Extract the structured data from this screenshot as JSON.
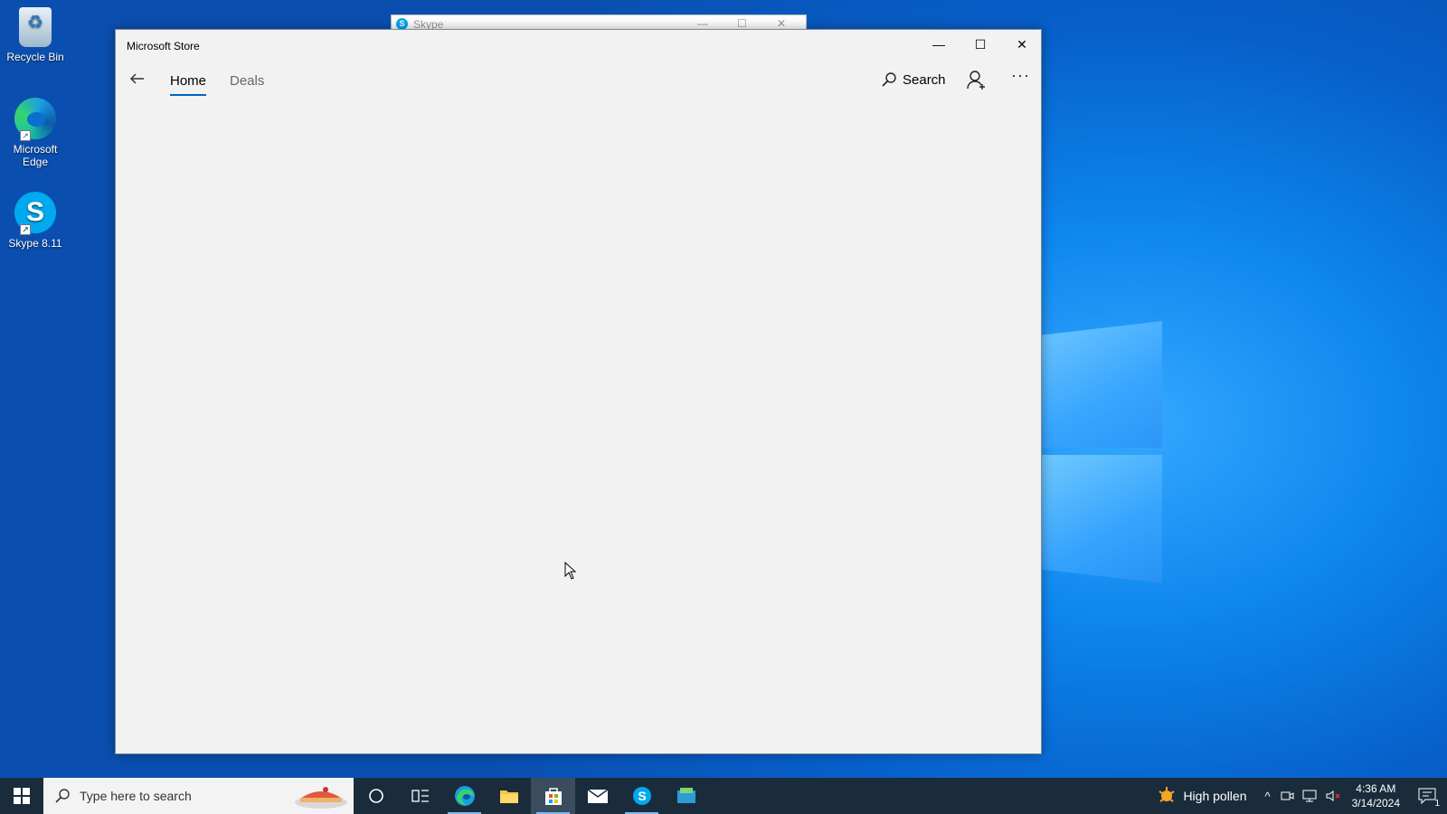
{
  "desktop": {
    "icons": [
      {
        "label": "Recycle Bin"
      },
      {
        "label": "Microsoft Edge"
      },
      {
        "label": "Skype 8.11"
      }
    ]
  },
  "background_window": {
    "title": "Skype"
  },
  "window": {
    "title": "Microsoft Store",
    "controls": {
      "minimize": "—",
      "maximize": "☐",
      "close": "✕"
    }
  },
  "nav": {
    "tabs": [
      {
        "label": "Home",
        "active": true
      },
      {
        "label": "Deals",
        "active": false
      }
    ],
    "search_label": "Search",
    "more_label": "···"
  },
  "taskbar": {
    "search_placeholder": "Type here to search",
    "weather_text": "High pollen",
    "time": "4:36 AM",
    "date": "3/14/2024",
    "notification_count": "1",
    "apps": [
      "cortana-icon",
      "task-view-icon",
      "edge-icon",
      "file-explorer-icon",
      "store-icon",
      "mail-icon",
      "skype-icon",
      "app-icon"
    ],
    "accent_color": "#0067c0"
  }
}
